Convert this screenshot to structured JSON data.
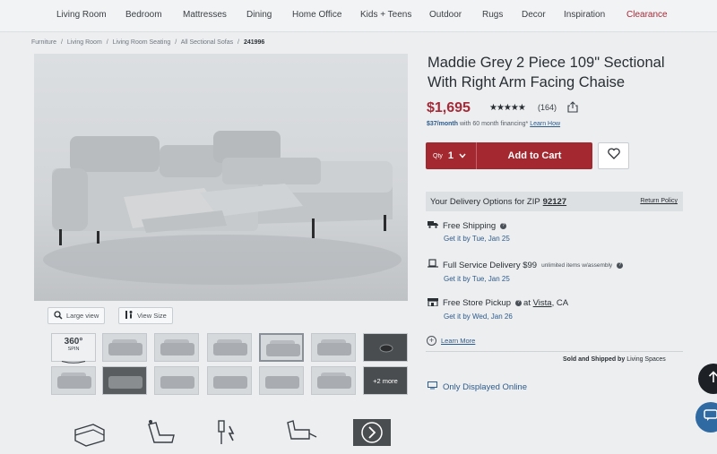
{
  "nav": {
    "items": [
      "Living Room",
      "Bedroom",
      "Mattresses",
      "Dining",
      "Home Office",
      "Kids + Teens",
      "Outdoor",
      "Rugs",
      "Decor",
      "Inspiration",
      "Clearance"
    ]
  },
  "breadcrumb": {
    "items": [
      "Furniture",
      "Living Room",
      "Living Room Seating",
      "All Sectional Sofas"
    ],
    "current": "241996",
    "separator": "/"
  },
  "gallery": {
    "large_view_label": "Large view",
    "view_size_label": "View Size",
    "spin_number": "360°",
    "spin_label": "SPIN",
    "more_label": "+2 more"
  },
  "product": {
    "title": "Maddie Grey 2 Piece 109\" Sectional With Right Arm Facing Chaise",
    "price": "$1,695",
    "rating_stars": "★★★★★",
    "rating_value": 4.5,
    "review_count": "(164)",
    "finance_amount": "$37/month",
    "finance_text": "with 60 month financing*",
    "finance_link": "Learn How"
  },
  "cart": {
    "qty_label": "Qty",
    "qty_value": "1",
    "add_label": "Add to Cart"
  },
  "delivery": {
    "heading": "Your Delivery Options for ZIP",
    "zip": "92127",
    "return_policy": "Return Policy",
    "options": [
      {
        "title": "Free Shipping",
        "extra": "",
        "date": "Get it by Tue, Jan 25"
      },
      {
        "title": "Full Service Delivery $99",
        "extra": "unlimited items w/assembly",
        "date": "Get it by Tue, Jan 25"
      },
      {
        "title": "Free Store Pickup",
        "extra": "at",
        "store": "Vista",
        "state": ", CA",
        "date": "Get it by Wed, Jan 26"
      }
    ],
    "learn_more": "Learn More",
    "sold_by_label": "Sold and Shipped by",
    "sold_by_name": "Living Spaces",
    "only_online": "Only Displayed Online"
  },
  "colors": {
    "accent": "#a3282f",
    "link": "#2e5a8a",
    "clearance": "#a62a38",
    "chat": "#2f6aa3"
  },
  "icons": [
    "magnifier-icon",
    "ruler-person-icon",
    "share-icon",
    "heart-icon",
    "truck-icon",
    "delivery-box-icon",
    "store-icon",
    "plus-circle-icon",
    "monitor-icon",
    "arrow-up-icon",
    "chat-icon",
    "sofa-feature-icon",
    "recliner-feature-icon",
    "power-cable-icon",
    "chair-feature-icon",
    "next-arrow-icon"
  ]
}
